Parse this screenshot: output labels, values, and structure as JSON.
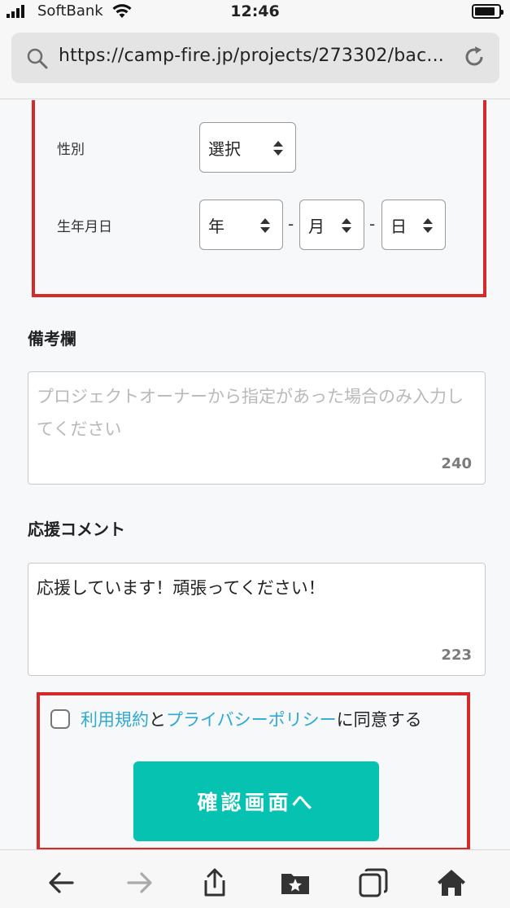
{
  "status_bar": {
    "carrier": "SoftBank",
    "time": "12:46"
  },
  "browser": {
    "url": "https://camp-fire.jp/projects/273302/bac..."
  },
  "form": {
    "gender": {
      "label": "性別",
      "selected": "選択"
    },
    "birthday": {
      "label": "生年月日",
      "year": "年",
      "month": "月",
      "day": "日",
      "separator": "-"
    },
    "remarks": {
      "title": "備考欄",
      "placeholder": "プロジェクトオーナーから指定があった場合のみ入力してください",
      "counter": "240"
    },
    "comment": {
      "title": "応援コメント",
      "value": "応援しています！頑張ってください！",
      "counter": "223"
    },
    "agreement": {
      "terms_link": "利用規約",
      "connector": "と",
      "privacy_link": "プライバシーポリシー",
      "suffix": "に同意する",
      "checked": false
    },
    "confirm_button": "確認画面へ"
  },
  "colors": {
    "highlight": "#d42a2a",
    "link": "#30a9d4",
    "button": "#05c3b0"
  },
  "toolbar": {
    "icons": [
      "back-arrow-icon",
      "forward-arrow-icon",
      "share-icon",
      "bookmarks-icon",
      "tabs-icon",
      "home-icon"
    ]
  }
}
